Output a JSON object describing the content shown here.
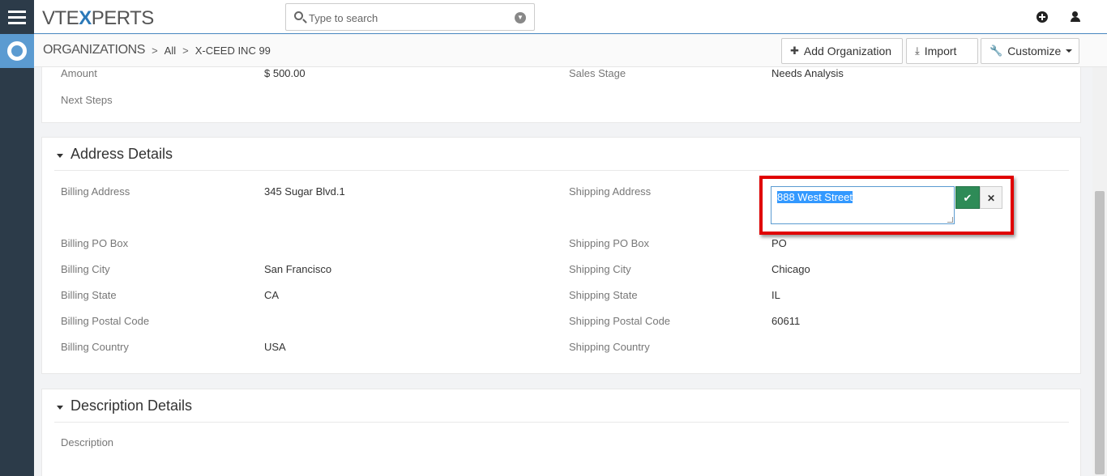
{
  "app": {
    "logo_pre": "VTE",
    "logo_x": "X",
    "logo_post": "PERTS"
  },
  "search": {
    "placeholder": "Type to search"
  },
  "breadcrumb": {
    "module": "ORGANIZATIONS",
    "filter": "All",
    "record": "X-CEED INC 99"
  },
  "actions": {
    "add_label": "Add Organization",
    "import_label": "Import",
    "customize_label": "Customize"
  },
  "icons": {
    "menu": "hamburger-menu-icon",
    "support": "lifering-icon",
    "search": "search-icon",
    "search_dropdown": "chevron-down-circle-icon",
    "quick_create": "plus-circle-icon",
    "user": "user-icon",
    "add": "plus-icon",
    "import": "download-icon",
    "customize": "wrench-icon",
    "save": "check-icon",
    "cancel": "close-icon"
  },
  "colors": {
    "rail": "#2c3b49",
    "support_tile": "#5b9bd1",
    "highlight_frame": "#e00000",
    "save_button": "#2e8b57"
  },
  "opportunity_section": {
    "amount_label": "Amount",
    "amount_value": "$ 500.00",
    "sales_stage_label": "Sales Stage",
    "sales_stage_value": "Needs Analysis",
    "next_steps_label": "Next Steps"
  },
  "address_section": {
    "title": "Address Details",
    "billing_address_label": "Billing Address",
    "billing_address_value": "345 Sugar Blvd.1",
    "shipping_address_label": "Shipping Address",
    "shipping_address_value": "888 West Street",
    "billing_po_box_label": "Billing PO Box",
    "shipping_po_box_label": "Shipping PO Box",
    "shipping_po_box_value": "PO",
    "billing_city_label": "Billing City",
    "billing_city_value": "San Francisco",
    "shipping_city_label": "Shipping City",
    "shipping_city_value": "Chicago",
    "billing_state_label": "Billing State",
    "billing_state_value": "CA",
    "shipping_state_label": "Shipping State",
    "shipping_state_value": "IL",
    "billing_postal_label": "Billing Postal Code",
    "shipping_postal_label": "Shipping Postal Code",
    "shipping_postal_value": "60611",
    "billing_country_label": "Billing Country",
    "billing_country_value": "USA",
    "shipping_country_label": "Shipping Country"
  },
  "description_section": {
    "title": "Description Details",
    "description_label": "Description"
  }
}
